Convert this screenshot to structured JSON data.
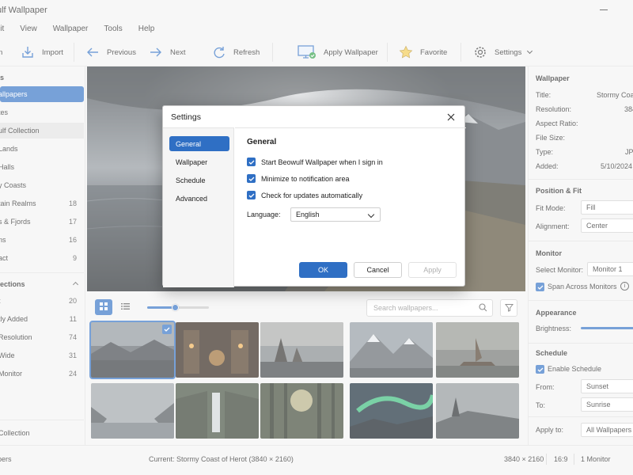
{
  "app": {
    "title": "ulf Wallpaper"
  },
  "menu": [
    "lit",
    "View",
    "Wallpaper",
    "Tools",
    "Help"
  ],
  "toolbar": {
    "open_label": "n",
    "import_label": "Import",
    "previous_label": "Previous",
    "next_label": "Next",
    "refresh_label": "Refresh",
    "apply_label": "Apply Wallpaper",
    "favorite_label": "Favorite",
    "settings_label": "Settings"
  },
  "sidebar": {
    "section1_head": "s",
    "items": [
      {
        "label": "allpapers",
        "count": ""
      },
      {
        "label": "tes",
        "count": ""
      },
      {
        "label": "ulf Collection",
        "count": ""
      },
      {
        "label": "Lands",
        "count": ""
      },
      {
        "label": "Halls",
        "count": ""
      },
      {
        "label": "y Coasts",
        "count": ""
      },
      {
        "label": "tain Realms",
        "count": "18"
      },
      {
        "label": "s & Fjords",
        "count": "17"
      },
      {
        "label": "ns",
        "count": "16"
      },
      {
        "label": "act",
        "count": "9"
      }
    ],
    "section2_head": "ections",
    "collections": [
      {
        "label": "t",
        "count": "20"
      },
      {
        "label": "tly Added",
        "count": "11"
      },
      {
        "label": "Resolution",
        "count": "74"
      },
      {
        "label": "Wide",
        "count": "31"
      },
      {
        "label": "Monitor",
        "count": "24"
      }
    ],
    "footer_label": "Collection"
  },
  "gallery": {
    "search_placeholder": "Search wallpapers...",
    "slider_value": 0.45
  },
  "right_panel": {
    "wallpaper_head": "Wallpaper",
    "title_label": "Title:",
    "title_value": "Stormy Coast",
    "resolution_label": "Resolution:",
    "resolution_value": "384",
    "aspect_label": "Aspect Ratio:",
    "filesize_label": "File Size:",
    "type_label": "Type:",
    "type_value": "JP",
    "added_label": "Added:",
    "added_value": "5/10/2024",
    "position_head": "Position & Fit",
    "fitmode_label": "Fit Mode:",
    "fitmode_value": "Fill",
    "alignment_label": "Alignment:",
    "alignment_value": "Center",
    "monitor_head": "Monitor",
    "select_monitor_label": "Select Monitor:",
    "select_monitor_value": "Monitor 1",
    "span_label": "Span Across Monitors",
    "appearance_head": "Appearance",
    "brightness_label": "Brightness:",
    "schedule_head": "Schedule",
    "enable_schedule_label": "Enable Schedule",
    "from_label": "From:",
    "from_value": "Sunset",
    "to_label": "To:",
    "to_value": "Sunrise",
    "applyto_label": "Apply to:",
    "applyto_value": "All Wallpapers"
  },
  "status": {
    "left": "pers",
    "current": "Current: Stormy Coast of Herot (3840 × 2160)",
    "resolution": "3840 × 2160",
    "aspect": "16:9",
    "monitors": "1 Monitor"
  },
  "dialog": {
    "title": "Settings",
    "nav": [
      "General",
      "Wallpaper",
      "Schedule",
      "Advanced"
    ],
    "heading": "General",
    "options": [
      "Start Beowulf Wallpaper when I sign in",
      "Minimize to notification area",
      "Check for updates automatically"
    ],
    "language_label": "Language:",
    "language_value": "English",
    "ok_label": "OK",
    "cancel_label": "Cancel",
    "apply_label": "Apply"
  },
  "colors": {
    "accent": "#2f6fc4"
  }
}
